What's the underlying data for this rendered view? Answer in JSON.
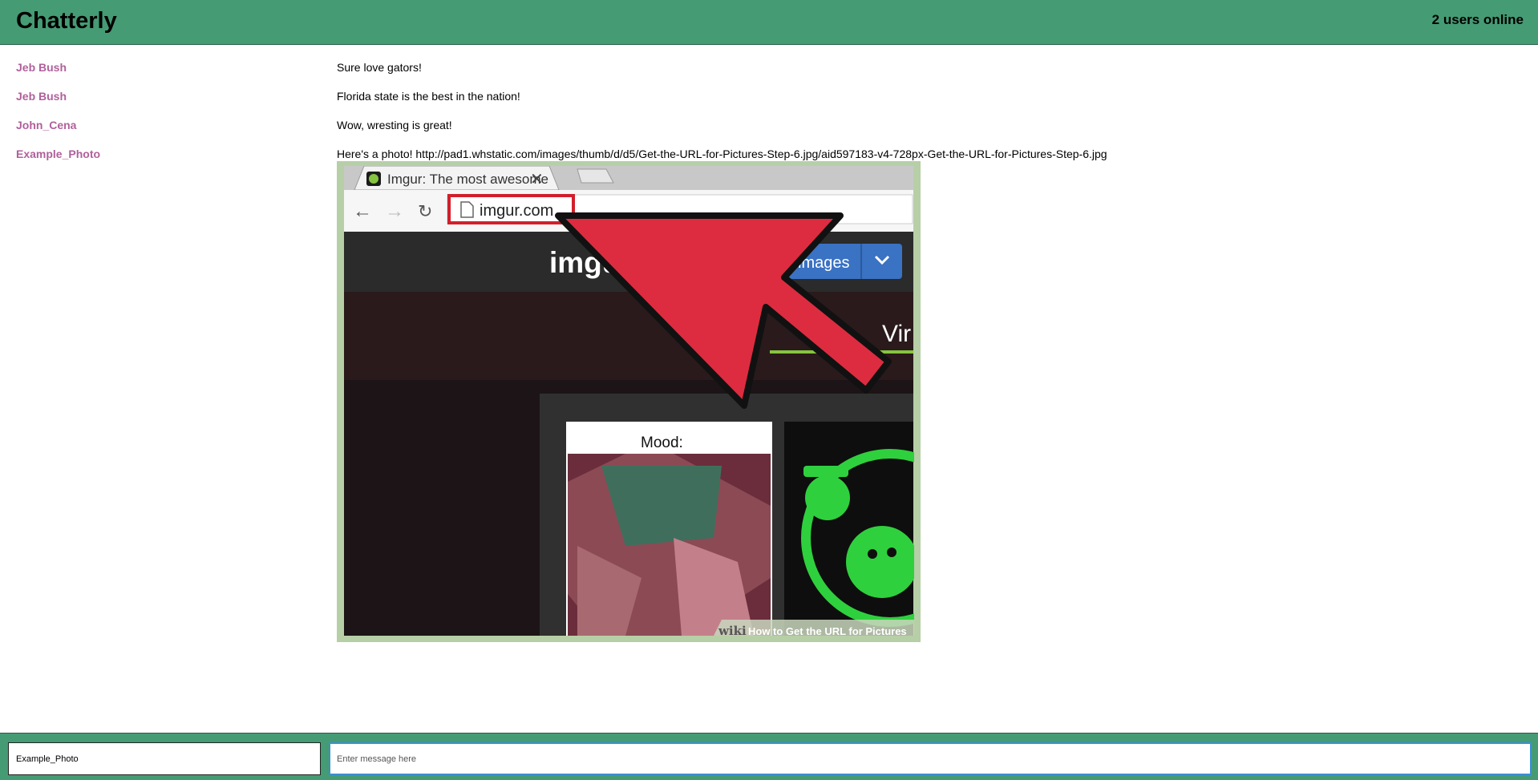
{
  "header": {
    "title": "Chatterly",
    "users_online": "2 users online"
  },
  "messages": [
    {
      "user": "Jeb Bush",
      "text": "Sure love gators!"
    },
    {
      "user": "Jeb Bush",
      "text": "Florida state is the best in the nation!"
    },
    {
      "user": "John_Cena",
      "text": "Wow, wresting is great!"
    },
    {
      "user": "Example_Photo",
      "text": "Here's a photo! http://pad1.whstatic.com/images/thumb/d/d5/Get-the-URL-for-Pictures-Step-6.jpg/aid597183-v4-728px-Get-the-URL-for-Pictures-Step-6.jpg"
    }
  ],
  "photo": {
    "tab_title": "Imgur: The most awesome",
    "address": "imgur.com",
    "brand": "imgu",
    "button_label": "images",
    "side_text": "Vir",
    "card_label": "Mood:",
    "watermark_prefix": "wiki",
    "watermark_caption": "How to Get the URL for Pictures"
  },
  "footer": {
    "name_value": "Example_Photo",
    "message_placeholder": "Enter message here"
  },
  "colors": {
    "header_bg": "#459b74",
    "username": "#b0609b",
    "arrow": "#dd2c40",
    "input_focus": "#3b8fd0"
  }
}
